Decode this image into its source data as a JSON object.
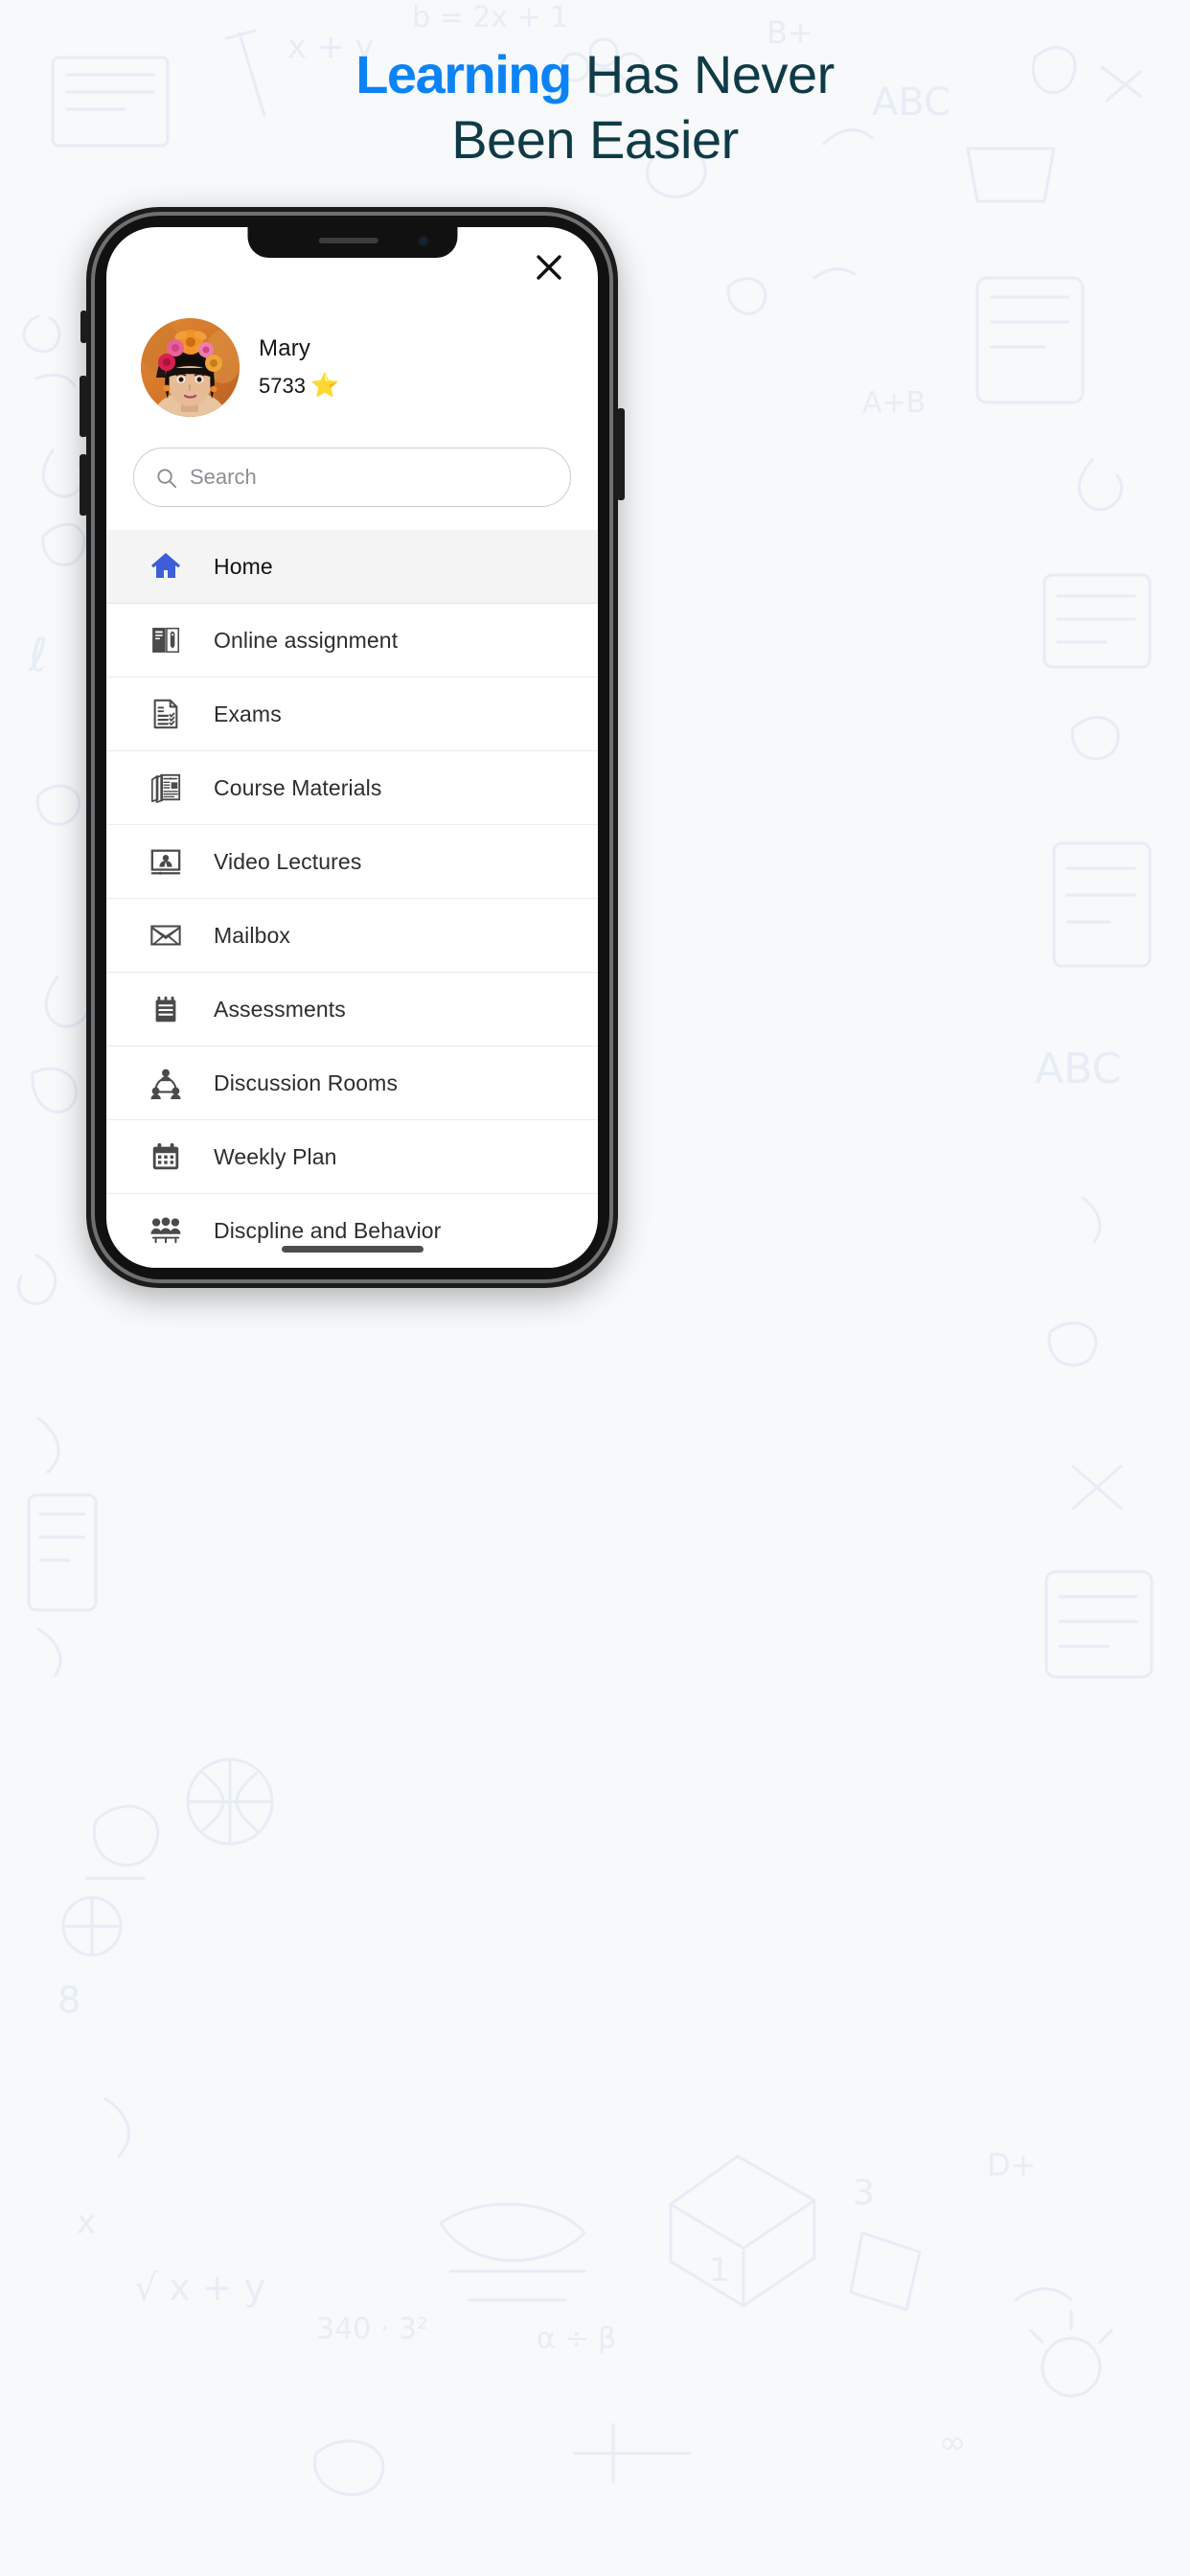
{
  "page": {
    "background_color": "#f7f9fb",
    "accent_color": "#0c83f5",
    "heading_color": "#0f3b47"
  },
  "headline": {
    "line1_accent": "Learning",
    "line1_rest": " Has Never",
    "line2": "Been Easier"
  },
  "app": {
    "close_icon": "close-icon",
    "profile": {
      "name": "Mary",
      "score": "5733",
      "star": "⭐",
      "avatar_alt": "girl-with-flower-crown-photo"
    },
    "search": {
      "placeholder": "Search",
      "value": "",
      "icon": "search-icon"
    },
    "menu": [
      {
        "label": "Home",
        "icon": "home-icon",
        "active": true
      },
      {
        "label": "Online assignment",
        "icon": "book-pencil-icon",
        "active": false
      },
      {
        "label": "Exams",
        "icon": "checklist-document-icon",
        "active": false
      },
      {
        "label": "Course Materials",
        "icon": "newspaper-stack-icon",
        "active": false
      },
      {
        "label": "Video Lectures",
        "icon": "monitor-presenter-icon",
        "active": false
      },
      {
        "label": "Mailbox",
        "icon": "envelope-icon",
        "active": false
      },
      {
        "label": "Assessments",
        "icon": "notepad-icon",
        "active": false
      },
      {
        "label": "Discussion Rooms",
        "icon": "people-network-icon",
        "active": false
      },
      {
        "label": "Weekly Plan",
        "icon": "calendar-icon",
        "active": false
      },
      {
        "label": "Discpline and Behavior",
        "icon": "group-people-icon",
        "active": false
      }
    ]
  }
}
